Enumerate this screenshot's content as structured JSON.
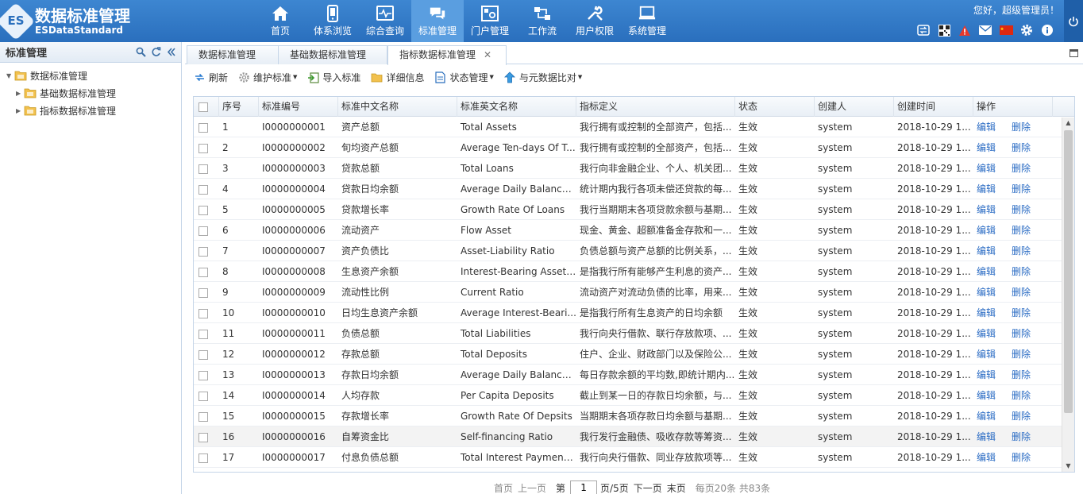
{
  "app": {
    "title": "数据标准管理",
    "subtitle": "ESDataStandard",
    "logo_letters": "ES"
  },
  "nav": [
    {
      "label": "首页",
      "icon": "home-icon"
    },
    {
      "label": "体系浏览",
      "icon": "phone-icon"
    },
    {
      "label": "综合查询",
      "icon": "monitor-icon"
    },
    {
      "label": "标准管理",
      "icon": "chat-icon",
      "active": true
    },
    {
      "label": "门户管理",
      "icon": "portal-icon"
    },
    {
      "label": "工作流",
      "icon": "workflow-icon"
    },
    {
      "label": "用户权限",
      "icon": "tools-icon"
    },
    {
      "label": "系统管理",
      "icon": "laptop-icon"
    }
  ],
  "header": {
    "greeting": "您好，超级管理员！",
    "tools": [
      "switch-icon",
      "qrcode-icon",
      "alert-icon",
      "mail-icon",
      "flag-icon",
      "gear-icon",
      "info-icon"
    ]
  },
  "left": {
    "title": "标准管理",
    "tree": [
      {
        "label": "数据标准管理",
        "level": 0,
        "expanded": true
      },
      {
        "label": "基础数据标准管理",
        "level": 1,
        "expanded": false
      },
      {
        "label": "指标数据标准管理",
        "level": 1,
        "expanded": false
      }
    ]
  },
  "tabs": [
    {
      "label": "数据标准管理",
      "active": false
    },
    {
      "label": "基础数据标准管理",
      "active": false
    },
    {
      "label": "指标数据标准管理",
      "active": true,
      "close": "✕"
    }
  ],
  "toolbar": [
    {
      "label": "刷新",
      "icon": "refresh-icon"
    },
    {
      "label": "维护标准",
      "icon": "gear-icon",
      "dropdown": true
    },
    {
      "label": "导入标准",
      "icon": "import-icon"
    },
    {
      "label": "详细信息",
      "icon": "folder-icon"
    },
    {
      "label": "状态管理",
      "icon": "document-icon",
      "dropdown": true
    },
    {
      "label": "与元数据比对",
      "icon": "upload-icon",
      "dropdown": true
    }
  ],
  "grid": {
    "columns": [
      "序号",
      "标准编号",
      "标准中文名称",
      "标准英文名称",
      "指标定义",
      "状态",
      "创建人",
      "创建时间",
      "操作"
    ],
    "edit_label": "编辑",
    "delete_label": "删除",
    "rows": [
      [
        "1",
        "I0000000001",
        "资产总额",
        "Total Assets",
        "我行拥有或控制的全部资产，包括...",
        "生效",
        "system",
        "2018-10-29 1..."
      ],
      [
        "2",
        "I0000000002",
        "旬均资产总额",
        "Average Ten-days Of T...",
        "我行拥有或控制的全部资产，包括...",
        "生效",
        "system",
        "2018-10-29 1..."
      ],
      [
        "3",
        "I0000000003",
        "贷款总额",
        "Total Loans",
        "我行向非金融企业、个人、机关团...",
        "生效",
        "system",
        "2018-10-29 1..."
      ],
      [
        "4",
        "I0000000004",
        "贷款日均余额",
        "Average Daily Balance ...",
        "统计期内我行各项未偿还贷款的每...",
        "生效",
        "system",
        "2018-10-29 1..."
      ],
      [
        "5",
        "I0000000005",
        "贷款增长率",
        "Growth Rate Of Loans",
        "我行当期期末各项贷款余额与基期...",
        "生效",
        "system",
        "2018-10-29 1..."
      ],
      [
        "6",
        "I0000000006",
        "流动资产",
        "Flow Asset",
        "现金、黄金、超额准备金存款和一...",
        "生效",
        "system",
        "2018-10-29 1..."
      ],
      [
        "7",
        "I0000000007",
        "资产负债比",
        "Asset-Liability Ratio",
        "负债总额与资产总额的比例关系，...",
        "生效",
        "system",
        "2018-10-29 1..."
      ],
      [
        "8",
        "I0000000008",
        "生息资产余额",
        "Interest-Bearing Asset ...",
        "是指我行所有能够产生利息的资产...",
        "生效",
        "system",
        "2018-10-29 1..."
      ],
      [
        "9",
        "I0000000009",
        "流动性比例",
        "Current Ratio",
        "流动资产对流动负债的比率，用来...",
        "生效",
        "system",
        "2018-10-29 1..."
      ],
      [
        "10",
        "I0000000010",
        "日均生息资产余额",
        "Average Interest-Beari...",
        "是指我行所有生息资产的日均余额",
        "生效",
        "system",
        "2018-10-29 1..."
      ],
      [
        "11",
        "I0000000011",
        "负债总额",
        "Total Liabilities",
        "我行向央行借款、联行存放款项、...",
        "生效",
        "system",
        "2018-10-29 1..."
      ],
      [
        "12",
        "I0000000012",
        "存款总额",
        "Total Deposits",
        "住户、企业、财政部门以及保险公...",
        "生效",
        "system",
        "2018-10-29 1..."
      ],
      [
        "13",
        "I0000000013",
        "存款日均余额",
        "Average Daily Balance ...",
        "每日存款余额的平均数,即统计期内...",
        "生效",
        "system",
        "2018-10-29 1..."
      ],
      [
        "14",
        "I0000000014",
        "人均存款",
        "Per Capita Deposits",
        "截止到某一日的存款日均余额，与...",
        "生效",
        "system",
        "2018-10-29 1..."
      ],
      [
        "15",
        "I0000000015",
        "存款增长率",
        "Growth Rate Of Depsits",
        "当期期末各项存款日均余额与基期...",
        "生效",
        "system",
        "2018-10-29 1..."
      ],
      [
        "16",
        "I0000000016",
        "自筹资金比",
        "Self-financing Ratio",
        "我行发行金融债、吸收存款等筹资...",
        "生效",
        "system",
        "2018-10-29 1..."
      ],
      [
        "17",
        "I0000000017",
        "付息负债总额",
        "Total Interest Payment ...",
        "我行向央行借款、同业存放款项等...",
        "生效",
        "system",
        "2018-10-29 1..."
      ]
    ]
  },
  "pager": {
    "first": "首页",
    "prev": "上一页",
    "page_prefix": "第",
    "current_page": "1",
    "page_suffix": "页/5页",
    "next": "下一页",
    "last": "末页",
    "summary": "每页20条 共83条"
  }
}
